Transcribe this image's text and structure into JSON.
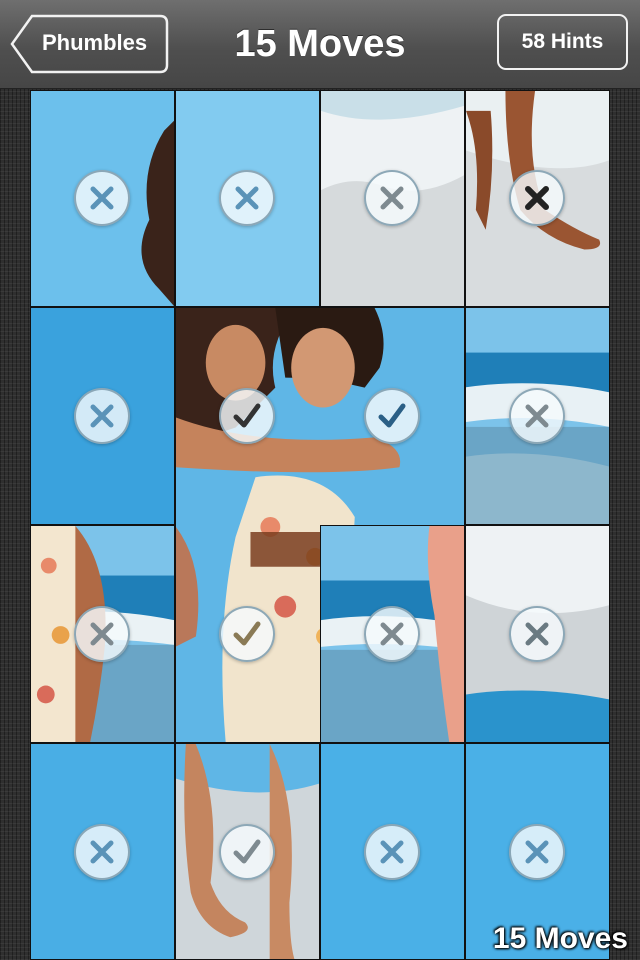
{
  "navbar": {
    "back_label": "Phumbles",
    "title": "15 Moves",
    "hints_label": "58 Hints"
  },
  "overlay": {
    "moves_text": "15 Moves"
  },
  "board": {
    "columns": 4,
    "rows": 4,
    "merged_correct_block": {
      "cols": [
        1,
        2
      ],
      "rows": [
        1,
        2
      ],
      "note": "2x2 tiles already in correct place shown as one picture"
    },
    "tiles": [
      {
        "id": "r0c0",
        "state": "wrong"
      },
      {
        "id": "r0c1",
        "state": "wrong"
      },
      {
        "id": "r0c2",
        "state": "wrong"
      },
      {
        "id": "r0c3",
        "state": "wrong-dark"
      },
      {
        "id": "r1c0",
        "state": "wrong"
      },
      {
        "id": "r1c1",
        "state": "correct"
      },
      {
        "id": "r1c2",
        "state": "correct-blue"
      },
      {
        "id": "r1c3",
        "state": "wrong"
      },
      {
        "id": "r2c0",
        "state": "wrong"
      },
      {
        "id": "r2c1",
        "state": "correct"
      },
      {
        "id": "r2c2",
        "state": "wrong"
      },
      {
        "id": "r2c3",
        "state": "wrong"
      },
      {
        "id": "r3c0",
        "state": "wrong"
      },
      {
        "id": "r3c1",
        "state": "correct"
      },
      {
        "id": "r3c2",
        "state": "wrong"
      },
      {
        "id": "r3c3",
        "state": "wrong"
      }
    ]
  },
  "colors": {
    "sky": "#5fb6e6",
    "sea": "#2b8fc6",
    "sand": "#d9dde0",
    "marker_wrong": "#5a93b8",
    "marker_dark": "#222222"
  }
}
